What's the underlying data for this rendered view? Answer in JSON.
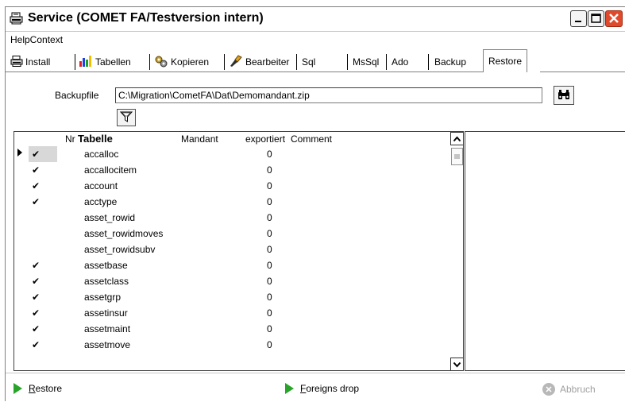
{
  "window": {
    "title": "Service (COMET FA/Testversion intern)"
  },
  "menu": {
    "items": [
      "HelpContext"
    ]
  },
  "tabs": [
    {
      "label": "Install",
      "icon": "printer-icon"
    },
    {
      "label": "Tabellen",
      "icon": "table-chart-icon"
    },
    {
      "label": "Kopieren",
      "icon": "gears-icon"
    },
    {
      "label": "Bearbeiter",
      "icon": "edit-tool-icon"
    },
    {
      "label": "Sql",
      "icon": ""
    },
    {
      "label": "MsSql",
      "icon": ""
    },
    {
      "label": "Ado",
      "icon": ""
    },
    {
      "label": "Backup",
      "icon": ""
    },
    {
      "label": "Restore",
      "icon": "",
      "active": true
    }
  ],
  "backup": {
    "label": "Backupfile",
    "value": "C:\\Migration\\CometFA\\Dat\\Demomandant.zip",
    "browse_icon": "binoculars-icon"
  },
  "filter": {
    "icon": "funnel-icon"
  },
  "grid": {
    "columns": {
      "nr": "Nr",
      "tabelle": "Tabelle",
      "mandant": "Mandant",
      "exportiert": "exportiert",
      "comment": "Comment"
    },
    "rows": [
      {
        "check": "✔",
        "tabelle": "accalloc",
        "exportiert": "0",
        "current": true
      },
      {
        "check": "✔",
        "tabelle": "accallocitem",
        "exportiert": "0"
      },
      {
        "check": "✔",
        "tabelle": "account",
        "exportiert": "0"
      },
      {
        "check": "✔",
        "tabelle": "acctype",
        "exportiert": "0"
      },
      {
        "check": "",
        "tabelle": "asset_rowid",
        "exportiert": "0"
      },
      {
        "check": "",
        "tabelle": "asset_rowidmoves",
        "exportiert": "0"
      },
      {
        "check": "",
        "tabelle": "asset_rowidsubv",
        "exportiert": "0"
      },
      {
        "check": "✔",
        "tabelle": "assetbase",
        "exportiert": "0"
      },
      {
        "check": "✔",
        "tabelle": "assetclass",
        "exportiert": "0"
      },
      {
        "check": "✔",
        "tabelle": "assetgrp",
        "exportiert": "0"
      },
      {
        "check": "✔",
        "tabelle": "assetinsur",
        "exportiert": "0"
      },
      {
        "check": "✔",
        "tabelle": "assetmaint",
        "exportiert": "0"
      },
      {
        "check": "✔",
        "tabelle": "assetmove",
        "exportiert": "0"
      }
    ]
  },
  "actions": {
    "restore": {
      "first": "R",
      "rest": "estore"
    },
    "foreigns": {
      "first": "F",
      "rest": "oreigns drop"
    },
    "abort": {
      "label": "Abbruch"
    }
  },
  "colors": {
    "accent_green": "#2aa32a",
    "close_button": "#e04a2c",
    "disabled_text": "#a0a0a0"
  }
}
